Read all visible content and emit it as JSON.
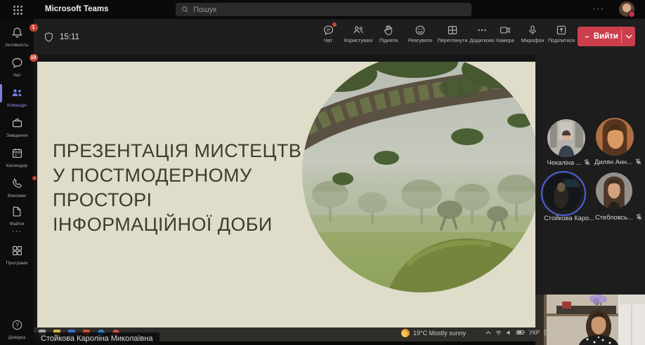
{
  "topbar": {
    "app_title": "Microsoft Teams",
    "search_placeholder": "Пошук",
    "more_label": "···"
  },
  "sidebar": {
    "items": [
      {
        "label": "Активність",
        "badge": "1"
      },
      {
        "label": "Чат",
        "badge": "10"
      },
      {
        "label": "Команди"
      },
      {
        "label": "Завдання"
      },
      {
        "label": "Календар"
      },
      {
        "label": "Виклики"
      },
      {
        "label": "Файли"
      },
      {
        "label": "···"
      },
      {
        "label": "Програми"
      },
      {
        "label": "Довідка"
      }
    ]
  },
  "toolbar": {
    "timer": "15:11",
    "buttons": [
      {
        "label": "Чат"
      },
      {
        "label": "Користувачі"
      },
      {
        "label": "Підняти"
      },
      {
        "label": "Реагувати"
      },
      {
        "label": "Переглянути"
      },
      {
        "label": "Додатково"
      },
      {
        "label": "Камера"
      },
      {
        "label": "Мікрофон"
      },
      {
        "label": "Поділитися"
      }
    ],
    "leave_label": "Вийти"
  },
  "slide": {
    "title": "ПРЕЗЕНТАЦІЯ МИСТЕЦТВ\nУ ПОСТМОДЕРНОМУ\nПРОСТОРІ\nІНФОРМАЦІЙНОЇ ДОБИ"
  },
  "participants": [
    {
      "name": "Чекаліна ...",
      "muted": true
    },
    {
      "name": "Дилян Анн...",
      "muted": true
    },
    {
      "name": "Стойкова Каро...",
      "muted": false
    },
    {
      "name": "Стебловсь...",
      "muted": true
    }
  ],
  "presenter_label": "Стойкова Кароліна Миколаївна",
  "shared_taskbar": {
    "weather": "19°C  Mostly sunny",
    "lang": "УКР"
  },
  "colors": {
    "accent_red": "#cd3e4d",
    "badge_red": "#c74634",
    "teams_blue": "#7b80e0",
    "slide_bg": "#dfdcca"
  }
}
